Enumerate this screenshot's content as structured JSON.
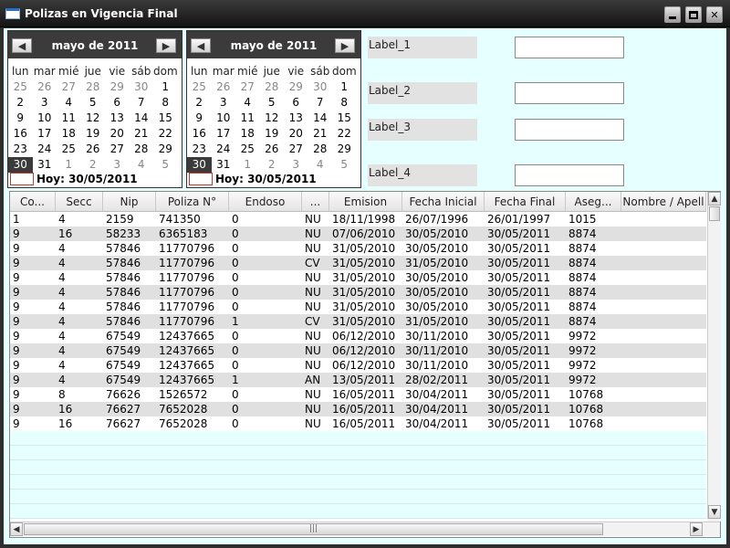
{
  "window": {
    "title": "Polizas en Vigencia Final",
    "controls": {
      "minimize": "minimize",
      "maximize": "maximize",
      "close": "✕"
    }
  },
  "calendars": [
    {
      "month": "mayo de 2011",
      "prev": "◀",
      "next": "▶",
      "today": "Hoy: 30/05/2011",
      "weekdays": [
        "lun",
        "mar",
        "mié",
        "jue",
        "vie",
        "sáb",
        "dom"
      ],
      "weeks": [
        [
          {
            "d": "25",
            "o": true
          },
          {
            "d": "26",
            "o": true
          },
          {
            "d": "27",
            "o": true
          },
          {
            "d": "28",
            "o": true
          },
          {
            "d": "29",
            "o": true
          },
          {
            "d": "30",
            "o": true
          },
          {
            "d": "1"
          }
        ],
        [
          {
            "d": "2"
          },
          {
            "d": "3"
          },
          {
            "d": "4"
          },
          {
            "d": "5"
          },
          {
            "d": "6"
          },
          {
            "d": "7"
          },
          {
            "d": "8"
          }
        ],
        [
          {
            "d": "9"
          },
          {
            "d": "10"
          },
          {
            "d": "11"
          },
          {
            "d": "12"
          },
          {
            "d": "13"
          },
          {
            "d": "14"
          },
          {
            "d": "15"
          }
        ],
        [
          {
            "d": "16"
          },
          {
            "d": "17"
          },
          {
            "d": "18"
          },
          {
            "d": "19"
          },
          {
            "d": "20"
          },
          {
            "d": "21"
          },
          {
            "d": "22"
          }
        ],
        [
          {
            "d": "23"
          },
          {
            "d": "24"
          },
          {
            "d": "25"
          },
          {
            "d": "26"
          },
          {
            "d": "27"
          },
          {
            "d": "28"
          },
          {
            "d": "29"
          }
        ],
        [
          {
            "d": "30",
            "s": true
          },
          {
            "d": "31"
          },
          {
            "d": "1",
            "o": true
          },
          {
            "d": "2",
            "o": true
          },
          {
            "d": "3",
            "o": true
          },
          {
            "d": "4",
            "o": true
          },
          {
            "d": "5",
            "o": true
          }
        ]
      ]
    },
    {
      "month": "mayo de 2011",
      "prev": "◀",
      "next": "▶",
      "today": "Hoy: 30/05/2011",
      "weekdays": [
        "lun",
        "mar",
        "mié",
        "jue",
        "vie",
        "sáb",
        "dom"
      ],
      "weeks": [
        [
          {
            "d": "25",
            "o": true
          },
          {
            "d": "26",
            "o": true
          },
          {
            "d": "27",
            "o": true
          },
          {
            "d": "28",
            "o": true
          },
          {
            "d": "29",
            "o": true
          },
          {
            "d": "30",
            "o": true
          },
          {
            "d": "1"
          }
        ],
        [
          {
            "d": "2"
          },
          {
            "d": "3"
          },
          {
            "d": "4"
          },
          {
            "d": "5"
          },
          {
            "d": "6"
          },
          {
            "d": "7"
          },
          {
            "d": "8"
          }
        ],
        [
          {
            "d": "9"
          },
          {
            "d": "10"
          },
          {
            "d": "11"
          },
          {
            "d": "12"
          },
          {
            "d": "13"
          },
          {
            "d": "14"
          },
          {
            "d": "15"
          }
        ],
        [
          {
            "d": "16"
          },
          {
            "d": "17"
          },
          {
            "d": "18"
          },
          {
            "d": "19"
          },
          {
            "d": "20"
          },
          {
            "d": "21"
          },
          {
            "d": "22"
          }
        ],
        [
          {
            "d": "23"
          },
          {
            "d": "24"
          },
          {
            "d": "25"
          },
          {
            "d": "26"
          },
          {
            "d": "27"
          },
          {
            "d": "28"
          },
          {
            "d": "29"
          }
        ],
        [
          {
            "d": "30",
            "s": true
          },
          {
            "d": "31"
          },
          {
            "d": "1",
            "o": true
          },
          {
            "d": "2",
            "o": true
          },
          {
            "d": "3",
            "o": true
          },
          {
            "d": "4",
            "o": true
          },
          {
            "d": "5",
            "o": true
          }
        ]
      ]
    }
  ],
  "form": {
    "labels": [
      "Label_1",
      "Label_2",
      "Label_3",
      "Label_4"
    ],
    "values": [
      "",
      "",
      "",
      ""
    ]
  },
  "table": {
    "columns": [
      "Co...",
      "Secc",
      "Nip",
      "Poliza N°",
      "Endoso",
      "...",
      "Emision",
      "Fecha Inicial",
      "Fecha Final",
      "Aseg...",
      "Nombre / Apell"
    ],
    "rows": [
      [
        "1",
        "4",
        "2159",
        "741350",
        "0",
        "NU",
        "18/11/1998",
        "26/07/1996",
        "26/01/1997",
        "1015",
        ""
      ],
      [
        "9",
        "16",
        "58233",
        "6365183",
        "0",
        "NU",
        "07/06/2010",
        "30/05/2010",
        "30/05/2011",
        "8874",
        ""
      ],
      [
        "9",
        "4",
        "57846",
        "11770796",
        "0",
        "NU",
        "31/05/2010",
        "30/05/2010",
        "30/05/2011",
        "8874",
        ""
      ],
      [
        "9",
        "4",
        "57846",
        "11770796",
        "0",
        "CV",
        "31/05/2010",
        "31/05/2010",
        "30/05/2011",
        "8874",
        ""
      ],
      [
        "9",
        "4",
        "57846",
        "11770796",
        "0",
        "NU",
        "31/05/2010",
        "30/05/2010",
        "30/05/2011",
        "8874",
        ""
      ],
      [
        "9",
        "4",
        "57846",
        "11770796",
        "0",
        "NU",
        "31/05/2010",
        "30/05/2010",
        "30/05/2011",
        "8874",
        ""
      ],
      [
        "9",
        "4",
        "57846",
        "11770796",
        "0",
        "NU",
        "31/05/2010",
        "30/05/2010",
        "30/05/2011",
        "8874",
        ""
      ],
      [
        "9",
        "4",
        "57846",
        "11770796",
        "1",
        "CV",
        "31/05/2010",
        "31/05/2010",
        "30/05/2011",
        "8874",
        ""
      ],
      [
        "9",
        "4",
        "67549",
        "12437665",
        "0",
        "NU",
        "06/12/2010",
        "30/11/2010",
        "30/05/2011",
        "9972",
        ""
      ],
      [
        "9",
        "4",
        "67549",
        "12437665",
        "0",
        "NU",
        "06/12/2010",
        "30/11/2010",
        "30/05/2011",
        "9972",
        ""
      ],
      [
        "9",
        "4",
        "67549",
        "12437665",
        "0",
        "NU",
        "06/12/2010",
        "30/11/2010",
        "30/05/2011",
        "9972",
        ""
      ],
      [
        "9",
        "4",
        "67549",
        "12437665",
        "1",
        "AN",
        "13/05/2011",
        "28/02/2011",
        "30/05/2011",
        "9972",
        ""
      ],
      [
        "9",
        "8",
        "76626",
        "1526572",
        "0",
        "NU",
        "16/05/2011",
        "30/04/2011",
        "30/05/2011",
        "10768",
        ""
      ],
      [
        "9",
        "16",
        "76627",
        "7652028",
        "0",
        "NU",
        "16/05/2011",
        "30/04/2011",
        "30/05/2011",
        "10768",
        ""
      ],
      [
        "9",
        "16",
        "76627",
        "7652028",
        "0",
        "NU",
        "16/05/2011",
        "30/04/2011",
        "30/05/2011",
        "10768",
        ""
      ]
    ]
  },
  "scrollbars": {
    "up": "▲",
    "down": "▼",
    "left": "◀",
    "right": "▶",
    "grip": "|||"
  }
}
